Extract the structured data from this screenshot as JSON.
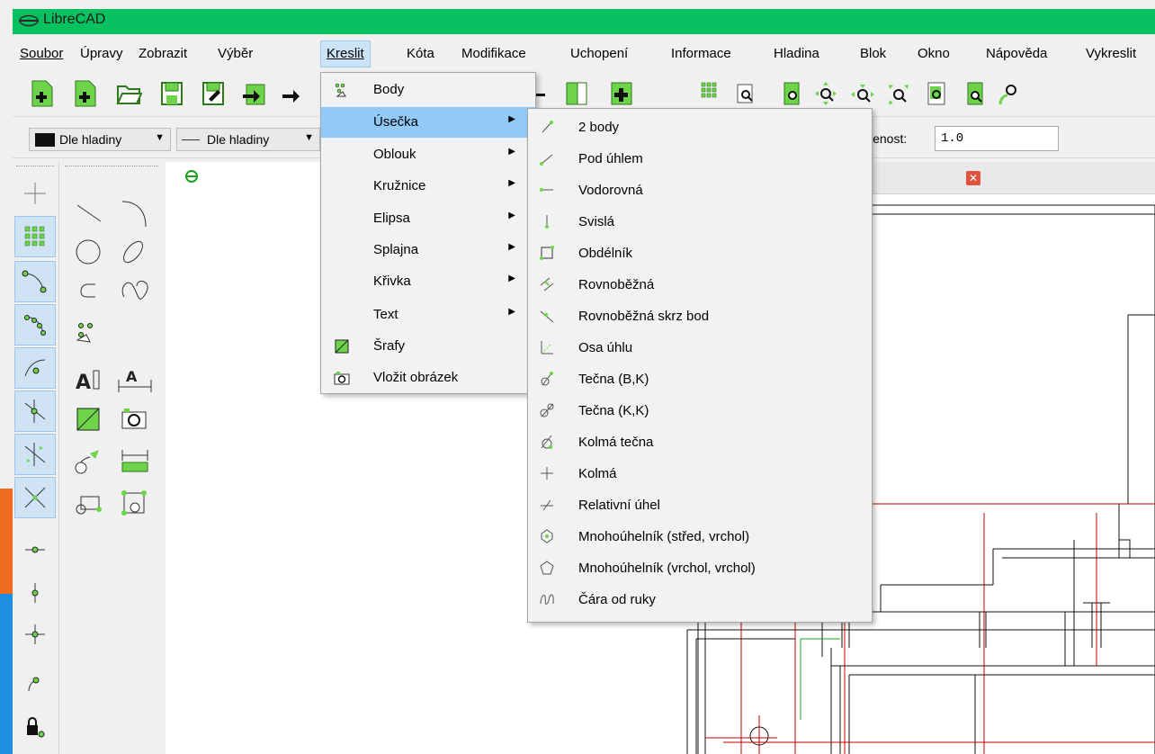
{
  "window": {
    "title": "LibreCAD"
  },
  "menubar": [
    {
      "label": "Soubor"
    },
    {
      "label": "Úpravy"
    },
    {
      "label": "Zobrazit"
    },
    {
      "label": "Výběr"
    },
    {
      "label": "Kreslit"
    },
    {
      "label": "Kóta"
    },
    {
      "label": "Modifikace"
    },
    {
      "label": "Uchopení"
    },
    {
      "label": "Informace"
    },
    {
      "label": "Hladina"
    },
    {
      "label": "Blok"
    },
    {
      "label": "Okno"
    },
    {
      "label": "Nápověda"
    },
    {
      "label": "Vykreslit"
    }
  ],
  "properties_bar": {
    "color_combo": "Dle hladiny",
    "linetype_combo": "Dle hladiny",
    "thickness_label": "lenost:",
    "thickness_value": "1.0"
  },
  "kreslit_menu": {
    "items": [
      {
        "label": "Body",
        "icon": "points-icon"
      },
      {
        "label": "Úsečka",
        "submenu": true
      },
      {
        "label": "Oblouk",
        "submenu": true
      },
      {
        "label": "Kružnice",
        "submenu": true
      },
      {
        "label": "Elipsa",
        "submenu": true
      },
      {
        "label": "Splajna",
        "submenu": true
      },
      {
        "label": "Křivka",
        "submenu": true
      },
      {
        "label": "Text",
        "submenu": true
      },
      {
        "label": "Šrafy",
        "icon": "hatch-icon"
      },
      {
        "label": "Vložit obrázek",
        "icon": "insert-image-icon"
      }
    ]
  },
  "line_submenu": {
    "items": [
      {
        "label": "2 body",
        "icon": "line-2points-icon"
      },
      {
        "label": "Pod úhlem",
        "icon": "line-angle-icon"
      },
      {
        "label": "Vodorovná",
        "icon": "line-horizontal-icon"
      },
      {
        "label": "Svislá",
        "icon": "line-vertical-icon"
      },
      {
        "label": "Obdélník",
        "icon": "rectangle-icon"
      },
      {
        "label": "Rovnoběžná",
        "icon": "parallel-icon"
      },
      {
        "label": "Rovnoběžná skrz bod",
        "icon": "parallel-through-point-icon"
      },
      {
        "label": "Osa úhlu",
        "icon": "bisector-icon"
      },
      {
        "label": "Tečna (B,K)",
        "icon": "tangent-pc-icon"
      },
      {
        "label": "Tečna (K,K)",
        "icon": "tangent-cc-icon"
      },
      {
        "label": "Kolmá tečna",
        "icon": "orthogonal-tangent-icon"
      },
      {
        "label": "Kolmá",
        "icon": "orthogonal-icon"
      },
      {
        "label": "Relativní úhel",
        "icon": "relative-angle-icon"
      },
      {
        "label": "Mnohoúhelník (střed, vrchol)",
        "icon": "polygon-center-icon"
      },
      {
        "label": "Mnohoúhelník (vrchol, vrchol)",
        "icon": "polygon-corner-icon"
      },
      {
        "label": "Čára od ruky",
        "icon": "freehand-icon"
      }
    ]
  },
  "colors": {
    "titlebar": "#07c160",
    "menu_highlight": "#91c9f7",
    "drawing_lines": "#000000",
    "construction_red": "#c00000",
    "construction_green": "#1aa31a"
  }
}
